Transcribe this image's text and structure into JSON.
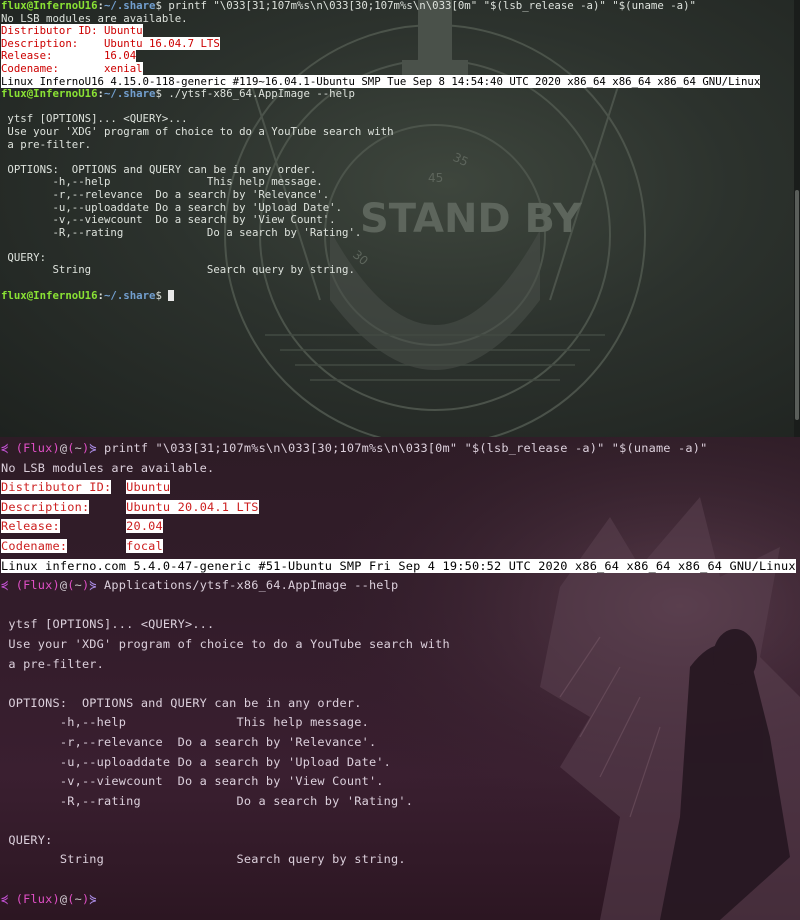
{
  "colors": {
    "prompt_user": "#8ae234",
    "prompt_path": "#729fcf",
    "alert_red": "#cc0000",
    "highlight_bg": "#ffffff",
    "prompt_magenta": "#e04fc6",
    "prompt_violet": "#a98be3"
  },
  "wallpaper_top": {
    "sign_text": "STAND BY",
    "dial_numbers": [
      "35",
      "45",
      "30"
    ]
  },
  "term1": {
    "prompt_user": "flux@InfernoU16",
    "prompt_path": "~/.share",
    "prompt_sym": "$",
    "cmd1": " printf \"\\033[31;107m%s\\n\\033[30;107m%s\\n\\033[0m\" \"$(lsb_release -a)\" \"$(uname -a)\"",
    "lsb_note": "No LSB modules are available.",
    "distributor": "Distributor ID: Ubuntu",
    "description": "Description:    Ubuntu 16.04.7 LTS",
    "release": "Release:        16.04",
    "codename": "Codename:       xenial",
    "uname": "Linux InfernoU16 4.15.0-118-generic #119~16.04.1-Ubuntu SMP Tue Sep 8 14:54:40 UTC 2020 x86_64 x86_64 x86_64 GNU/Linux",
    "cmd2": " ./ytsf-x86_64.AppImage --help",
    "help": [
      "",
      " ytsf [OPTIONS]... <QUERY>...",
      " Use your 'XDG' program of choice to do a YouTube search with",
      " a pre-filter.",
      "",
      " OPTIONS:  OPTIONS and QUERY can be in any order.",
      "        -h,--help               This help message.",
      "        -r,--relevance  Do a search by 'Relevance'.",
      "        -u,--uploaddate Do a search by 'Upload Date'.",
      "        -v,--viewcount  Do a search by 'View Count'.",
      "        -R,--rating             Do a search by 'Rating'.",
      "",
      " QUERY:",
      "        String                  Search query by string.",
      ""
    ]
  },
  "term2": {
    "prompt_arrow": "⋞",
    "prompt_name": "Flux",
    "prompt_at": "@",
    "prompt_dir": "~",
    "prompt_end": "⋟",
    "cmd1": " printf \"\\033[31;107m%s\\n\\033[30;107m%s\\n\\033[0m\" \"$(lsb_release -a)\" \"$(uname -a)\"",
    "lsb_note": "No LSB modules are available.",
    "distributor_label": "Distributor ID:",
    "distributor_value": "Ubuntu",
    "description_label": "Description:",
    "description_value": "Ubuntu 20.04.1 LTS",
    "release_label": "Release:",
    "release_value": "20.04",
    "codename_label": "Codename:",
    "codename_value": "focal",
    "uname": "Linux inferno.com 5.4.0-47-generic #51-Ubuntu SMP Fri Sep 4 19:50:52 UTC 2020 x86_64 x86_64 x86_64 GNU/Linux",
    "cmd2": " Applications/ytsf-x86_64.AppImage --help",
    "help": [
      "",
      " ytsf [OPTIONS]... <QUERY>...",
      " Use your 'XDG' program of choice to do a YouTube search with",
      " a pre-filter.",
      "",
      " OPTIONS:  OPTIONS and QUERY can be in any order.",
      "        -h,--help               This help message.",
      "        -r,--relevance  Do a search by 'Relevance'.",
      "        -u,--uploaddate Do a search by 'Upload Date'.",
      "        -v,--viewcount  Do a search by 'View Count'.",
      "        -R,--rating             Do a search by 'Rating'.",
      "",
      " QUERY:",
      "        String                  Search query by string.",
      ""
    ]
  }
}
